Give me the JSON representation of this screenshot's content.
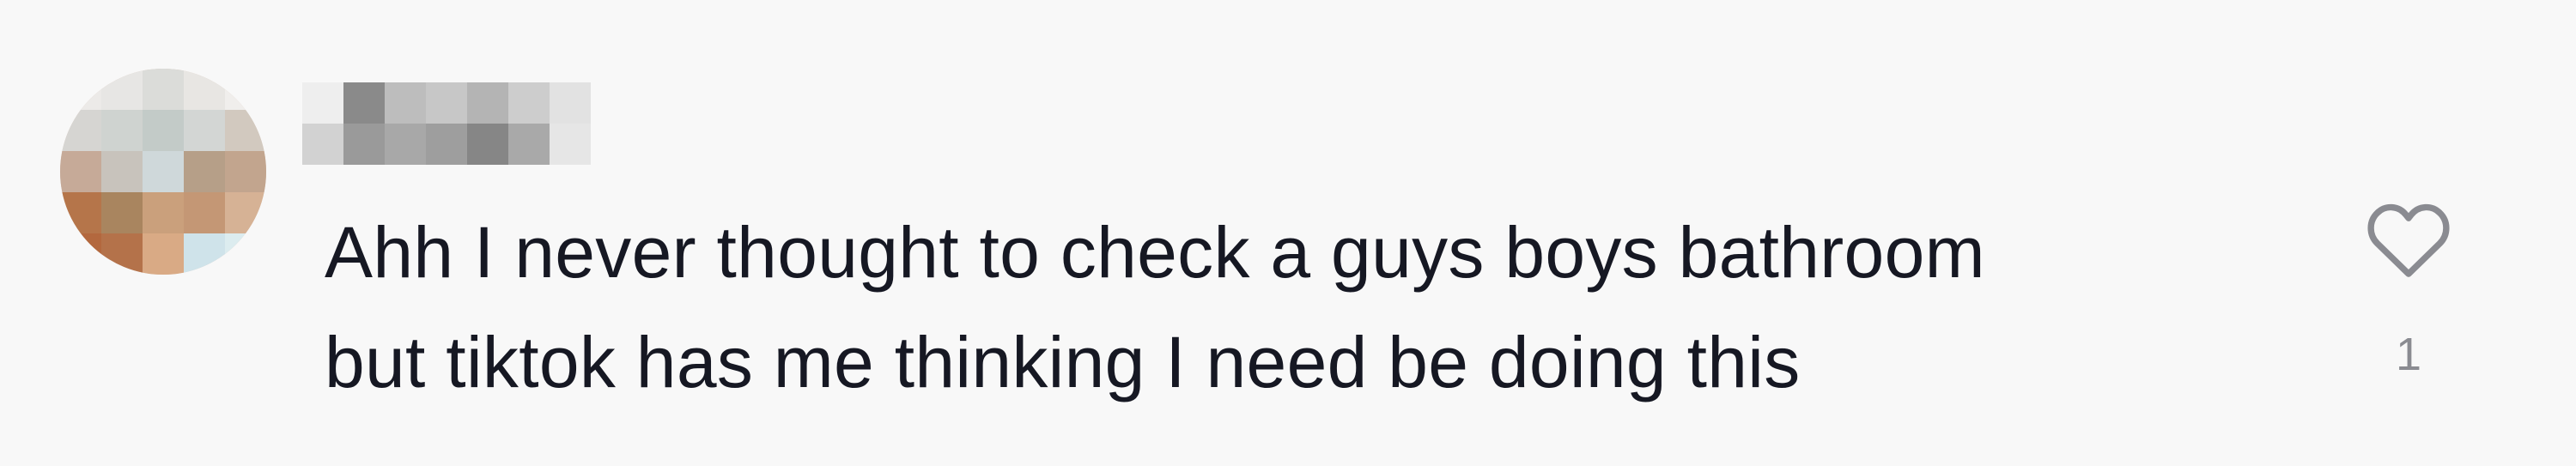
{
  "comment": {
    "text_lines": [
      "Ahh I never thought to check a guys boys bathroom",
      "but tiktok has me thinking I need be doing this"
    ],
    "like_count": "1"
  },
  "icons": {
    "like": "heart-outline-icon"
  },
  "colors": {
    "background": "#f8f8f8",
    "text": "#161823",
    "muted": "#8a8b91"
  }
}
